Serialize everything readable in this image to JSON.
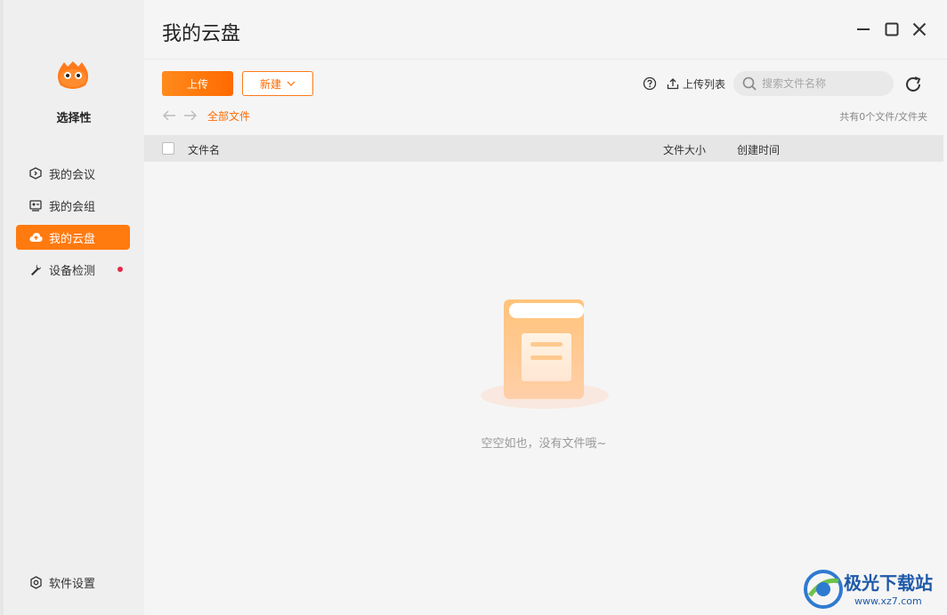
{
  "sidebar": {
    "user_name": "选择性",
    "items": [
      {
        "label": "我的会议",
        "icon": "meeting-icon"
      },
      {
        "label": "我的会组",
        "icon": "group-icon"
      },
      {
        "label": "我的云盘",
        "icon": "cloud-icon",
        "active": true
      },
      {
        "label": "设备检测",
        "icon": "wrench-icon",
        "badge": true
      }
    ],
    "settings_label": "软件设置"
  },
  "header": {
    "title": "我的云盘"
  },
  "toolbar": {
    "upload_label": "上传",
    "new_label": "新建",
    "upload_list_label": "上传列表",
    "search_placeholder": "搜索文件名称"
  },
  "breadcrumb": {
    "root": "全部文件",
    "count_text": "共有0个文件/文件夹"
  },
  "table": {
    "columns": [
      "文件名",
      "文件大小",
      "创建时间"
    ]
  },
  "empty_state": {
    "message": "空空如也，没有文件哦~"
  },
  "watermark": {
    "title": "极光下载站",
    "url": "www.xz7.com"
  },
  "colors": {
    "accent": "#ff7a0f",
    "badge": "#e5294a"
  }
}
